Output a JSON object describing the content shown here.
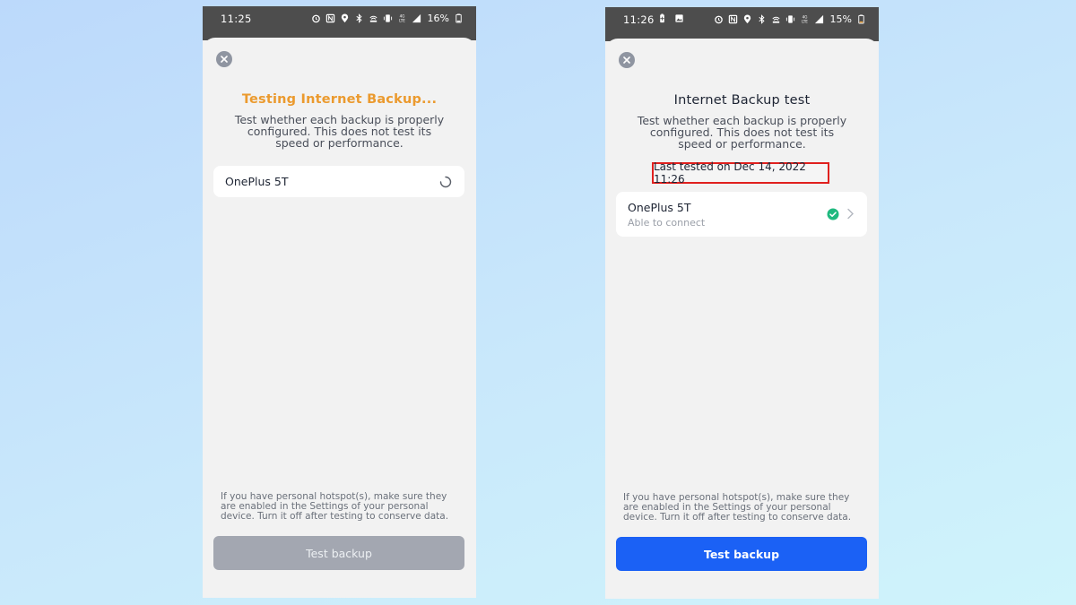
{
  "colors": {
    "testing_title": "#eb9a2e",
    "button_disabled": "#a3a7b1",
    "button_active": "#1b61f5",
    "success_check": "#1fb97f",
    "highlight_box": "#e0201e"
  },
  "left_screen": {
    "status_bar": {
      "time": "11:25",
      "battery": "16%",
      "icons": [
        "alarm-icon",
        "nfc-icon",
        "location-icon",
        "bluetooth-icon",
        "hotspot-icon",
        "vibrate-icon",
        "lte-icon",
        "signal-icon",
        "battery-icon"
      ]
    },
    "title": "Testing Internet Backup...",
    "description": "Test whether each backup is properly configured. This does not test its speed or performance.",
    "device": {
      "name": "OnePlus 5T",
      "state_icon": "spinner-icon"
    },
    "footer_note": "If you have personal hotspot(s), make sure they are enabled in the Settings of your personal device. Turn it off after testing to conserve data.",
    "button_label": "Test backup"
  },
  "right_screen": {
    "status_bar": {
      "time": "11:26",
      "battery": "15%",
      "icons": [
        "battery-saver-icon",
        "image-icon",
        "alarm-icon",
        "nfc-icon",
        "location-icon",
        "bluetooth-icon",
        "hotspot-icon",
        "vibrate-icon",
        "lte-icon",
        "signal-icon",
        "battery-icon"
      ]
    },
    "title": "Internet Backup test",
    "description": "Test whether each backup is properly configured. This does not test its speed or performance.",
    "last_tested": "Last tested on Dec 14, 2022 11:26",
    "device": {
      "name": "OnePlus 5T",
      "status": "Able to connect",
      "state_icon": "check-circle-icon"
    },
    "footer_note": "If you have personal hotspot(s), make sure they are enabled in the Settings of your personal device. Turn it off after testing to conserve data.",
    "button_label": "Test backup"
  }
}
